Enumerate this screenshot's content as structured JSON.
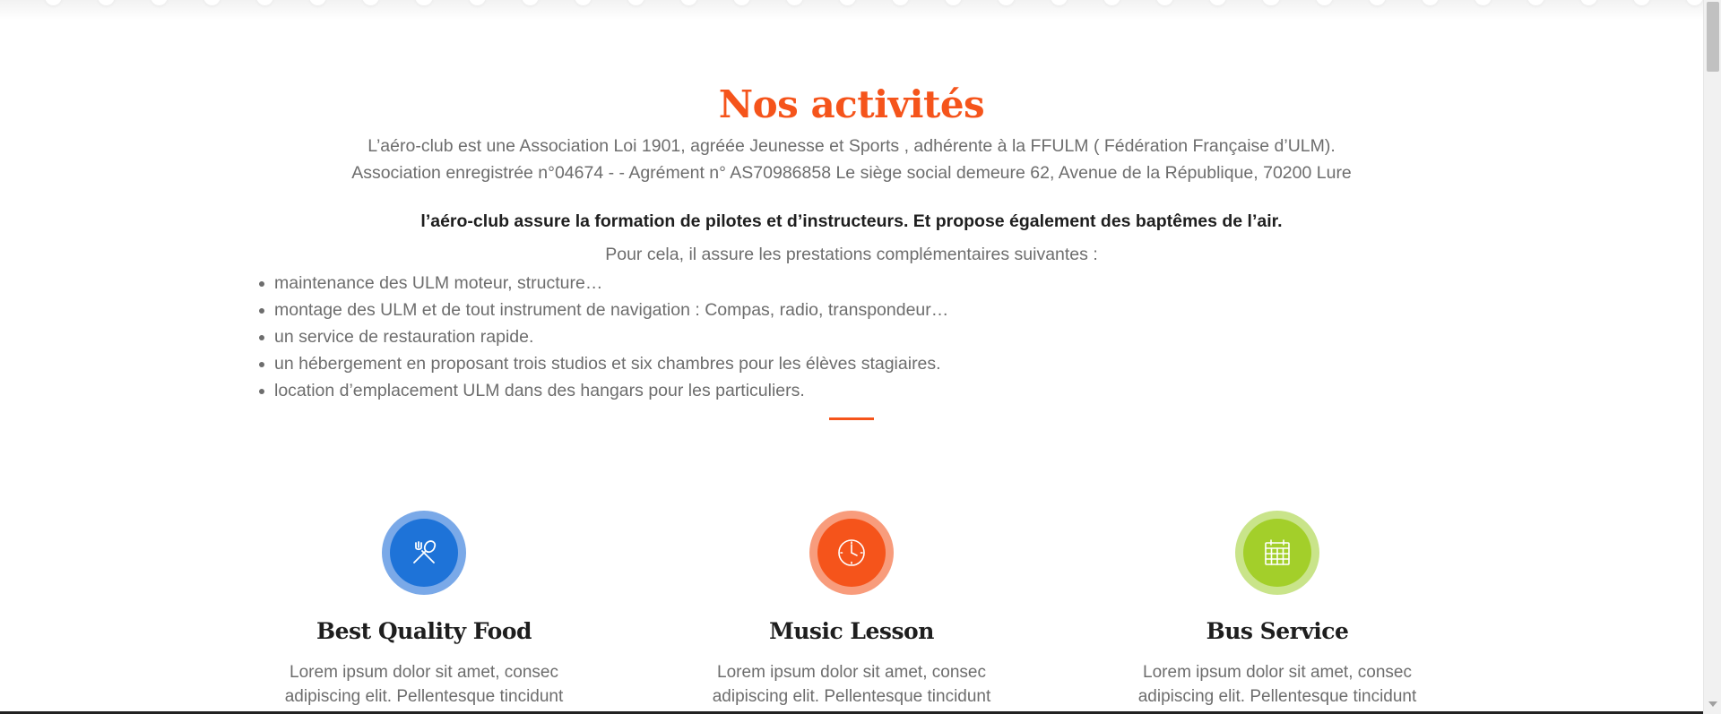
{
  "heading": "Nos activités",
  "intro_lines": [
    "L’aéro-club est une Association Loi 1901, agréée Jeunesse et Sports , adhérente à la FFULM ( Fédération Française d’ULM).",
    "Association enregistrée n°04674 - - Agrément n° AS70986858 Le siège social demeure 62, Avenue de la République, 70200 Lure"
  ],
  "bold_line": "l’aéro-club assure la formation de pilotes et d’instructeurs. Et propose également des baptêmes de l’air.",
  "pour_cela": "Pour cela, il assure les prestations complémentaires suivantes :",
  "services": [
    "maintenance des ULM moteur, structure…",
    "montage des ULM et de tout instrument de navigation : Compas, radio, transpondeur…",
    "un service de restauration rapide.",
    "un hébergement en proposant trois studios et six chambres pour les élèves stagiaires.",
    "location d’emplacement ULM dans des hangars pour les particuliers."
  ],
  "features": [
    {
      "title": "Best Quality Food",
      "text": "Lorem ipsum dolor sit amet, consec adipiscing elit. Pellentesque tincidunt rutrum sapien, sed",
      "icon": "fork-spoon-icon",
      "color": "#1e73d8",
      "ring_color": "#7aa9e8"
    },
    {
      "title": "Music Lesson",
      "text": "Lorem ipsum dolor sit amet, consec adipiscing elit. Pellentesque tincidunt rutrum sapien, sed",
      "icon": "clock-icon",
      "color": "#f5541b",
      "ring_color": "#f89c7c"
    },
    {
      "title": "Bus Service",
      "text": "Lorem ipsum dolor sit amet, consec adipiscing elit. Pellentesque tincidunt rutrum sapien, sed",
      "icon": "calendar-icon",
      "color": "#a3cf2a",
      "ring_color": "#c9e48a"
    }
  ],
  "colors": {
    "accent": "#f5541b",
    "text": "#6d6d6d",
    "heading_dark": "#1e1e1e"
  }
}
